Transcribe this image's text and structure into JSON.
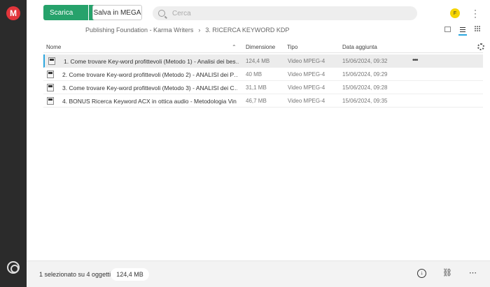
{
  "app": {
    "logo_letter": "M"
  },
  "toolbar": {
    "download_label": "Scarica",
    "save_label": "Salva in MEGA",
    "search_placeholder": "Cerca"
  },
  "user": {
    "avatar_initial": "F"
  },
  "breadcrumb": {
    "parent": "Publishing Foundation - Karma Writers",
    "separator": "›",
    "current": "3. RICERCA KEYWORD KDP"
  },
  "table": {
    "columns": [
      "Nome",
      "Dimensione",
      "Tipo",
      "Data aggiunta"
    ],
    "rows": [
      {
        "name": "1. Come trovare Key-word profittevoli (Metodo 1) - Analisi dei bes…",
        "size": "124,4 MB",
        "type": "Video MPEG-4",
        "date": "15/06/2024, 09:32",
        "selected": true
      },
      {
        "name": "2. Come trovare Key-word profittevoli (Metodo 2) - ANALISI dei P…",
        "size": "40 MB",
        "type": "Video MPEG-4",
        "date": "15/06/2024, 09:29",
        "selected": false
      },
      {
        "name": "3. Come trovare Key-word profittevoli (Metodo 3) - ANALISI dei C…",
        "size": "31,1 MB",
        "type": "Video MPEG-4",
        "date": "15/06/2024, 09:28",
        "selected": false
      },
      {
        "name": "4. BONUS Ricerca Keyword ACX in ottica audio - Metodologia Vin…",
        "size": "46,7 MB",
        "type": "Video MPEG-4",
        "date": "15/06/2024, 09:35",
        "selected": false
      }
    ]
  },
  "footer": {
    "selection_text": "1 selezionato su 4 oggetti",
    "selection_size": "124,4 MB"
  },
  "colors": {
    "accent_green": "#26a26b",
    "accent_blue": "#2ba6de",
    "brand_red": "#e2353b"
  }
}
